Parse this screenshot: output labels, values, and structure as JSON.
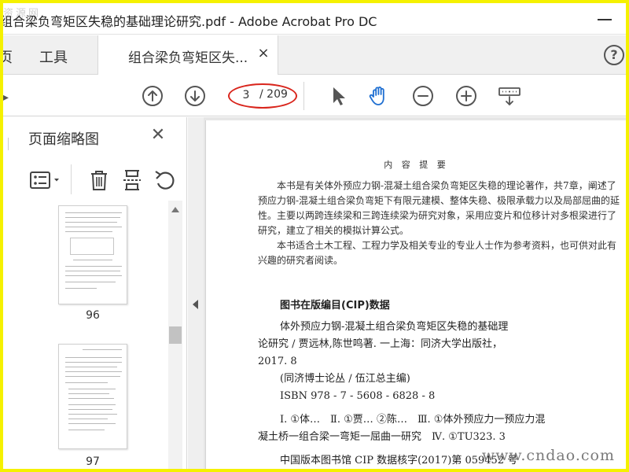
{
  "window": {
    "title": "组合梁负弯矩区失稳的基础理论研究.pdf - Adobe Acrobat Pro DC",
    "watermark_top": "资源网"
  },
  "tabs": {
    "home": "页",
    "tools": "工具",
    "document": "组合梁负弯矩区失...",
    "close": "×",
    "help": "?"
  },
  "toolbar": {
    "current_page": "3",
    "total_pages": "/ 209",
    "icons": [
      "arrow-up-icon",
      "arrow-down-icon",
      "select-arrow-icon",
      "hand-icon",
      "zoom-out-icon",
      "zoom-in-icon",
      "keyboard-icon"
    ],
    "accent": "#1f6fd1",
    "highlight": "#d9251c"
  },
  "sidebar": {
    "heading": "页面缩略图",
    "close": "✕",
    "thumbnails": [
      {
        "label": "96"
      },
      {
        "label": "97"
      }
    ]
  },
  "document": {
    "section_title": "内 容 提 要",
    "paragraphs": [
      "本书是有关体外预应力钢-混凝土组合梁负弯矩区失稳的理论著作，共7章，阐述了预应力钢-混凝土组合梁负弯矩下有限元建模、整体失稳、极限承载力以及局部屈曲的延性。主要以两跨连续梁和三跨连续梁为研究对象，采用应变片和位移计对多根梁进行了研究，建立了相关的模拟计算公式。",
      "本书适合土木工程、工程力学及相关专业的专业人士作为参考资料，也可供对此有兴趣的研究者阅读。"
    ],
    "cip_title": "图书在版编目(CIP)数据",
    "cip_lines": [
      "体外预应力钢-混凝土组合梁负弯矩区失稳的基础理",
      "论研究 / 贾远林,陈世鸣著. 一上海：同济大学出版社，",
      "2017. 8",
      "(同济博士论丛 / 伍江总主编)",
      "ISBN 978 - 7 - 5608 - 6828 - 8"
    ],
    "classification_lines": [
      "Ⅰ. ①体…　Ⅱ. ①贾…  ②陈…　Ⅲ. ①体外预应力一预应力混",
      "凝土桥一组合梁一弯矩一屈曲一研究　Ⅳ. ①TU323. 3"
    ],
    "cip_number": "中国版本图书馆 CIP 数据核字(2017)第 059452 号"
  },
  "watermark_bottom": "www.cndao.com"
}
